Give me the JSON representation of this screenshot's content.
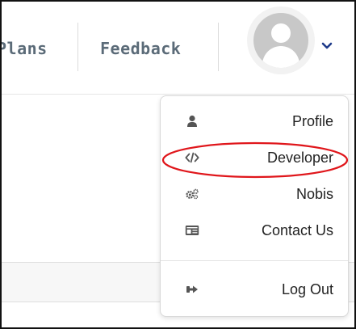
{
  "nav": {
    "plans_label": "Plans",
    "feedback_label": "Feedback"
  },
  "user_menu": {
    "items": [
      {
        "label": "Profile",
        "icon": "user-icon"
      },
      {
        "label": "Developer",
        "icon": "code-icon"
      },
      {
        "label": "Nobis",
        "icon": "gears-icon"
      },
      {
        "label": "Contact Us",
        "icon": "id-card-icon"
      },
      {
        "label": "Log Out",
        "icon": "sign-out-icon"
      }
    ]
  },
  "colors": {
    "nav_text": "#5b6b78",
    "menu_text": "#222222",
    "icon": "#555555",
    "annotation": "#e0161b",
    "chevron": "#1e3a8a"
  }
}
